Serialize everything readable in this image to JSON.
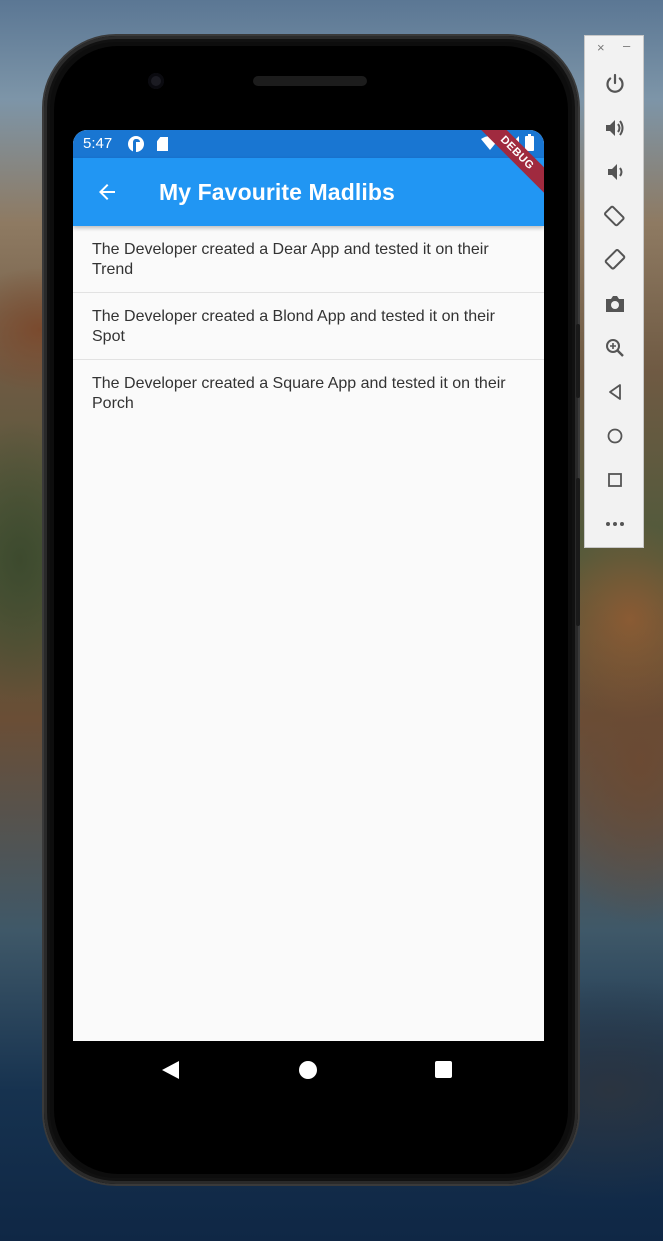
{
  "statusbar": {
    "time": "5:47"
  },
  "appbar": {
    "title": "My Favourite Madlibs",
    "debug_label": "DEBUG"
  },
  "madlibs": [
    "The Developer created a Dear App and tested it on their Trend",
    "The Developer created a Blond App and tested it on their Spot",
    "The Developer created a Square App and tested it on their Porch"
  ],
  "toolbar": {
    "close": "×",
    "minimize": "–",
    "buttons": [
      "power-icon",
      "volume-up-icon",
      "volume-down-icon",
      "rotate-left-icon",
      "rotate-right-icon",
      "camera-icon",
      "zoom-icon",
      "back-icon",
      "home-icon",
      "overview-icon",
      "more-icon"
    ]
  },
  "colors": {
    "statusbar": "#1976d2",
    "appbar": "#2196f3",
    "debug_banner": "#a02a3f",
    "screen_bg": "#fafafa"
  }
}
